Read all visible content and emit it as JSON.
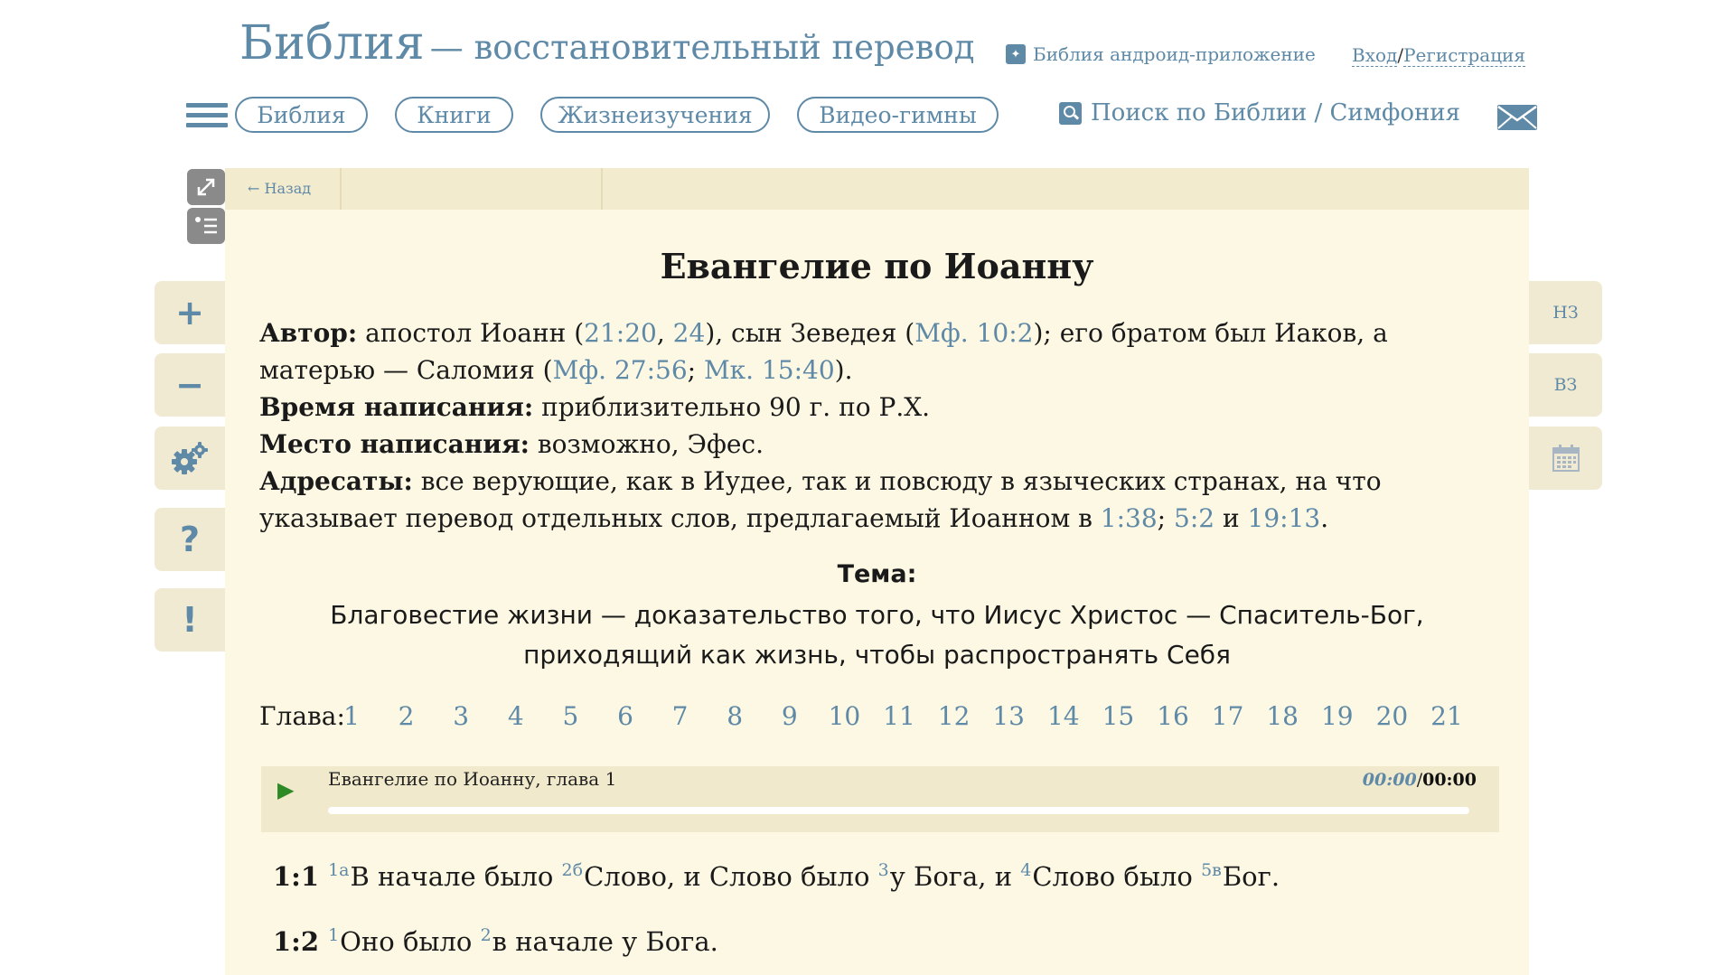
{
  "header": {
    "site_title_main": "Библия",
    "site_title_sub": "— восстановительный перевод",
    "app_link": "Библия андроид-приложение",
    "login": "Вход",
    "login_sep": "/",
    "register": "Регистрация"
  },
  "nav": {
    "items": [
      "Библия",
      "Книги",
      "Жизнеизучения",
      "Видео-гимны"
    ],
    "search": "Поиск по Библии / Симфония"
  },
  "side_left": {
    "zoom_in": "+",
    "zoom_out": "−",
    "help": "?",
    "note": "!"
  },
  "side_right": {
    "nt": "НЗ",
    "ot": "ВЗ"
  },
  "panel": {
    "back": "← Назад"
  },
  "book": {
    "title": "Евангелие по Иоанну",
    "author_label": "Автор:",
    "author_text_1": " апостол Иоанн (",
    "author_ref_1": "21:20",
    "author_text_2": ", ",
    "author_ref_2": "24",
    "author_text_3": "), сын Зеведея (",
    "author_ref_3": "Мф. 10:2",
    "author_text_4": "); его братом был Иаков, а матерью — Саломия (",
    "author_ref_4": "Мф. 27:56",
    "author_text_5": "; ",
    "author_ref_5": "Мк. 15:40",
    "author_text_6": ").",
    "time_label": "Время написания:",
    "time_text": " приблизительно 90 г. по Р.Х.",
    "place_label": "Место написания:",
    "place_text": " возможно, Эфес.",
    "recipients_label": "Адресаты:",
    "recipients_text_1": " все верующие, как в Иудее, так и повсюду в языческих странах, на что указывает перевод отдельных слов, предлагаемый Иоанном в ",
    "recipients_ref_1": "1:38",
    "recipients_text_2": "; ",
    "recipients_ref_2": "5:2",
    "recipients_text_3": " и ",
    "recipients_ref_3": "19:13",
    "recipients_text_4": ".",
    "theme_label": "Тема:",
    "theme_line_1": "Благовестие жизни — доказательство того, что Иисус Христос — Спаситель-Бог,",
    "theme_line_2": "приходящий как жизнь, чтобы распространять Себя"
  },
  "chapters": {
    "label": "Глава:",
    "items": [
      "1",
      "2",
      "3",
      "4",
      "5",
      "6",
      "7",
      "8",
      "9",
      "10",
      "11",
      "12",
      "13",
      "14",
      "15",
      "16",
      "17",
      "18",
      "19",
      "20",
      "21"
    ]
  },
  "player": {
    "play": "▶",
    "title": "Евангелие по Иоанну, глава 1",
    "current": "00:00",
    "sep": "/",
    "total": "00:00",
    "progress": 0
  },
  "verses": [
    {
      "num": "1:1",
      "parts": [
        {
          "sup": "1а",
          "text": "В начале было "
        },
        {
          "sup": "2б",
          "text": "Слово, и Слово было "
        },
        {
          "sup": "3",
          "text": "у Бога, и "
        },
        {
          "sup": "4",
          "text": "Слово было "
        },
        {
          "sup": "5в",
          "text": "Бог."
        }
      ]
    },
    {
      "num": "1:2",
      "parts": [
        {
          "sup": "1",
          "text": "Оно было "
        },
        {
          "sup": "2",
          "text": "в начале у Бога."
        }
      ]
    }
  ],
  "colors": {
    "accent": "#5e89a7",
    "panel": "#fdf8e3",
    "panel_bar": "#f3ebce",
    "side_button": "#f1ead2",
    "play": "#2d8a24"
  }
}
